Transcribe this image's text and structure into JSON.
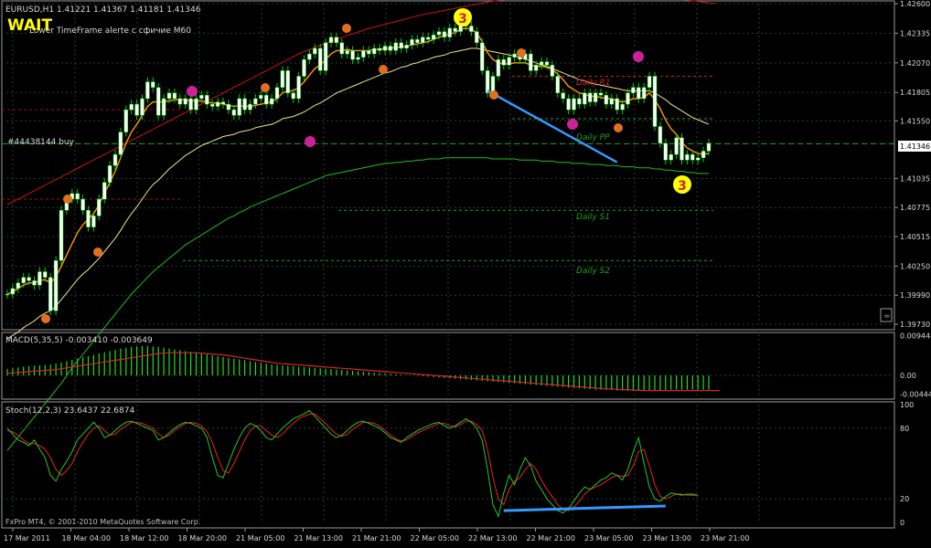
{
  "colors": {
    "bg": "#000000",
    "frame": "#9a9a9a",
    "grid": "#2a3a3a",
    "axis_text": "#d8d8d8",
    "bull": "#00d000",
    "bear": "#ffffff",
    "ma_fast": "#ff9900",
    "ma_mid": "#f0e68c",
    "ma_slow": "#22bb22",
    "envelope": "#cc1111",
    "price_line": "#20a020",
    "trend": "#3399ff",
    "marker": "#ffff00",
    "macd_hist": "#22dd22",
    "macd_signal": "#dd2222",
    "stoch_main": "#22cc22",
    "stoch_signal": "#ee2222"
  },
  "header": {
    "symbol_info": "EURUSD,H1  1.41221 1.41367 1.41181 1.41346",
    "wait_badge": "WAIT",
    "timeframe_note": "Lower TimeFrame alerte c сфичие M60",
    "order_label": "#44438144 buy",
    "watermark": "FxPro MT4, © 2001-2010 MetaQuotes Software Corp."
  },
  "pivot_labels": {
    "r1": "Daily R1",
    "pp": "Daily PP",
    "s1": "Daily S1",
    "s2": "Daily S2"
  },
  "wave_labels": {
    "top": "3",
    "bottom": "3"
  },
  "chart_data": [
    {
      "type": "line",
      "title": "EURUSD,H1",
      "ylim": [
        1.3973,
        1.426
      ],
      "y_ticks": [
        "1.42600",
        "1.42335",
        "1.42070",
        "1.41805",
        "1.41550",
        "1.41346",
        "1.41035",
        "1.40775",
        "1.40515",
        "1.40250",
        "1.39990",
        "1.39730"
      ],
      "current_price_label": "1.41346",
      "x_ticks": [
        "17 Mar 2011",
        "18 Mar 04:00",
        "18 Mar 12:00",
        "18 Mar 20:00",
        "21 Mar 05:00",
        "21 Mar 13:00",
        "21 Mar 21:00",
        "22 Mar 05:00",
        "22 Mar 13:00",
        "22 Mar 21:00",
        "23 Mar 05:00",
        "23 Mar 13:00",
        "23 Mar 21:00"
      ],
      "close": [
        1.4,
        1.4005,
        1.401,
        1.4015,
        1.4012,
        1.4008,
        1.402,
        1.4015,
        1.3985,
        1.403,
        1.4075,
        1.4085,
        1.409,
        1.4085,
        1.4075,
        1.406,
        1.407,
        1.4085,
        1.41,
        1.4115,
        1.4125,
        1.4145,
        1.4165,
        1.417,
        1.416,
        1.4175,
        1.419,
        1.4185,
        1.416,
        1.4175,
        1.418,
        1.4175,
        1.417,
        1.4175,
        1.4165,
        1.4175,
        1.4178,
        1.417,
        1.4168,
        1.4172,
        1.417,
        1.4165,
        1.416,
        1.4175,
        1.4165,
        1.417,
        1.4175,
        1.4178,
        1.417,
        1.4175,
        1.4185,
        1.42,
        1.418,
        1.4175,
        1.4195,
        1.421,
        1.4215,
        1.422,
        1.42,
        1.4225,
        1.423,
        1.4225,
        1.4215,
        1.4218,
        1.421,
        1.4212,
        1.4218,
        1.4215,
        1.422,
        1.4218,
        1.4222,
        1.4218,
        1.4225,
        1.422,
        1.4223,
        1.4228,
        1.4225,
        1.423,
        1.4228,
        1.4232,
        1.4235,
        1.423,
        1.4238,
        1.4235,
        1.4245,
        1.424,
        1.4235,
        1.4225,
        1.42,
        1.418,
        1.4195,
        1.421,
        1.4205,
        1.4212,
        1.4215,
        1.421,
        1.4215,
        1.42,
        1.4205,
        1.4208,
        1.4205,
        1.4195,
        1.418,
        1.4175,
        1.4165,
        1.4175,
        1.417,
        1.418,
        1.4172,
        1.418,
        1.4178,
        1.417,
        1.4175,
        1.4165,
        1.417,
        1.418,
        1.4185,
        1.4175,
        1.4185,
        1.4195,
        1.415,
        1.4135,
        1.412,
        1.4125,
        1.414,
        1.412,
        1.4125,
        1.412,
        1.4122,
        1.4128,
        1.4135
      ],
      "sma_fast": [
        1.4,
        1.4002,
        1.4005,
        1.4008,
        1.401,
        1.401,
        1.4012,
        1.4013,
        1.401,
        1.4015,
        1.4025,
        1.4035,
        1.4045,
        1.4055,
        1.4062,
        1.4067,
        1.4072,
        1.408,
        1.409,
        1.41,
        1.411,
        1.4122,
        1.4135,
        1.4145,
        1.4152,
        1.416,
        1.4168,
        1.4172,
        1.4172,
        1.4172,
        1.4173,
        1.4174,
        1.4174,
        1.4174,
        1.4173,
        1.4173,
        1.4173,
        1.4172,
        1.4171,
        1.4171,
        1.417,
        1.4169,
        1.4168,
        1.4169,
        1.4168,
        1.4168,
        1.4169,
        1.417,
        1.4171,
        1.4172,
        1.4175,
        1.418,
        1.4182,
        1.4182,
        1.4185,
        1.419,
        1.4196,
        1.4202,
        1.4205,
        1.421,
        1.4215,
        1.4218,
        1.4218,
        1.4219,
        1.4218,
        1.4218,
        1.4218,
        1.4218,
        1.4219,
        1.4219,
        1.422,
        1.422,
        1.4221,
        1.4221,
        1.4222,
        1.4223,
        1.4224,
        1.4225,
        1.4226,
        1.4228,
        1.423,
        1.4231,
        1.4233,
        1.4234,
        1.4237,
        1.4238,
        1.4237,
        1.4234,
        1.4226,
        1.4216,
        1.421,
        1.4207,
        1.4206,
        1.4206,
        1.4207,
        1.4207,
        1.4207,
        1.4205,
        1.4204,
        1.4204,
        1.4203,
        1.4201,
        1.4197,
        1.4192,
        1.4186,
        1.4183,
        1.418,
        1.4179,
        1.4177,
        1.4177,
        1.4176,
        1.4175,
        1.4175,
        1.4173,
        1.4172,
        1.4173,
        1.4175,
        1.4175,
        1.4176,
        1.418,
        1.4174,
        1.4166,
        1.4156,
        1.4148,
        1.4143,
        1.4136,
        1.4131,
        1.4128,
        1.4126,
        1.4125,
        1.4126
      ],
      "sma_mid": [
        1.396,
        1.3963,
        1.3966,
        1.397,
        1.3973,
        1.3976,
        1.398,
        1.3983,
        1.3985,
        1.3989,
        1.3995,
        1.4001,
        1.4007,
        1.4013,
        1.4018,
        1.4022,
        1.4027,
        1.4032,
        1.4038,
        1.4044,
        1.405,
        1.4057,
        1.4065,
        1.4072,
        1.4078,
        1.4085,
        1.4092,
        1.4098,
        1.4102,
        1.4107,
        1.4112,
        1.4116,
        1.412,
        1.4124,
        1.4127,
        1.413,
        1.4133,
        1.4135,
        1.4137,
        1.4139,
        1.4141,
        1.4142,
        1.4143,
        1.4145,
        1.4146,
        1.4147,
        1.4149,
        1.415,
        1.4151,
        1.4152,
        1.4154,
        1.4157,
        1.4158,
        1.4159,
        1.4161,
        1.4163,
        1.4166,
        1.4169,
        1.4171,
        1.4174,
        1.4177,
        1.418,
        1.4182,
        1.4184,
        1.4186,
        1.4188,
        1.419,
        1.4192,
        1.4194,
        1.4196,
        1.4198,
        1.4199,
        1.4201,
        1.4203,
        1.4204,
        1.4206,
        1.4207,
        1.4209,
        1.421,
        1.4212,
        1.4213,
        1.4214,
        1.4216,
        1.4217,
        1.4218,
        1.4219,
        1.422,
        1.422,
        1.4219,
        1.4218,
        1.4217,
        1.4216,
        1.4215,
        1.4214,
        1.4213,
        1.4212,
        1.421,
        1.4209,
        1.4207,
        1.4205,
        1.4204,
        1.4202,
        1.42,
        1.4198,
        1.4196,
        1.4194,
        1.4192,
        1.4191,
        1.4189,
        1.4188,
        1.4187,
        1.4186,
        1.4185,
        1.4184,
        1.4183,
        1.4182,
        1.4182,
        1.4182,
        1.4182,
        1.4182,
        1.418,
        1.4177,
        1.4174,
        1.417,
        1.4167,
        1.4164,
        1.4161,
        1.4158,
        1.4156,
        1.4154,
        1.4152
      ],
      "sma_slow": [
        1.386,
        1.3866,
        1.3872,
        1.3878,
        1.3884,
        1.389,
        1.3896,
        1.3902,
        1.3908,
        1.3914,
        1.392,
        1.3927,
        1.3934,
        1.394,
        1.3946,
        1.3952,
        1.3958,
        1.3964,
        1.397,
        1.3976,
        1.3982,
        1.3988,
        1.3994,
        1.4,
        1.4005,
        1.401,
        1.4015,
        1.402,
        1.4024,
        1.4028,
        1.4032,
        1.4036,
        1.404,
        1.4044,
        1.4047,
        1.405,
        1.4053,
        1.4056,
        1.4059,
        1.4062,
        1.4065,
        1.4068,
        1.407,
        1.4073,
        1.4075,
        1.4078,
        1.408,
        1.4082,
        1.4084,
        1.4086,
        1.4088,
        1.409,
        1.4092,
        1.4094,
        1.4096,
        1.4098,
        1.41,
        1.4102,
        1.4104,
        1.4106,
        1.4107,
        1.4108,
        1.4109,
        1.411,
        1.4111,
        1.4112,
        1.4113,
        1.4114,
        1.4115,
        1.4116,
        1.4117,
        1.4117,
        1.4118,
        1.4118,
        1.4119,
        1.4119,
        1.412,
        1.412,
        1.4121,
        1.4121,
        1.4121,
        1.4122,
        1.4122,
        1.4122,
        1.4122,
        1.4122,
        1.4122,
        1.4122,
        1.4122,
        1.4122,
        1.4121,
        1.4121,
        1.4121,
        1.4121,
        1.4121,
        1.412,
        1.412,
        1.412,
        1.412,
        1.4119,
        1.4119,
        1.4119,
        1.4118,
        1.4118,
        1.4118,
        1.4117,
        1.4117,
        1.4117,
        1.4116,
        1.4116,
        1.4116,
        1.4115,
        1.4115,
        1.4115,
        1.4114,
        1.4114,
        1.4114,
        1.4113,
        1.4113,
        1.4113,
        1.4112,
        1.4112,
        1.4111,
        1.4111,
        1.411,
        1.411,
        1.4109,
        1.4109,
        1.4108,
        1.4108,
        1.4108
      ],
      "envelope": [
        1.408,
        1.4088,
        1.4096,
        1.4104,
        1.4112,
        1.412,
        1.4128,
        1.4136,
        1.4144,
        1.4152,
        1.416,
        1.4168,
        1.4176,
        1.4184,
        1.4192,
        1.42,
        1.4208,
        1.4216,
        1.4222,
        1.4228,
        1.4233,
        1.4238,
        1.4242,
        1.4246,
        1.425,
        1.4253,
        1.4256,
        1.4259,
        1.4262,
        1.4264,
        1.4266,
        1.4268,
        1.4269,
        1.427,
        1.4269,
        1.4268,
        1.4267,
        1.4266,
        1.4265,
        1.4264,
        1.4262,
        1.426
      ],
      "pivots": {
        "r1": 1.4195,
        "pp": 1.4157,
        "s1": 1.4075,
        "s2": 1.403
      },
      "trend_line": [
        [
          89,
          1.4182
        ],
        [
          113,
          1.4118
        ]
      ]
    },
    {
      "type": "bar",
      "title": "MACD(5,35,5) -0.003410 -0.003649",
      "y_ticks": [
        "0.009448",
        "0.00",
        "-0.00444"
      ],
      "ylim": [
        -0.005,
        0.0098
      ],
      "histogram": [
        0.0015,
        0.0017,
        0.0019,
        0.0021,
        0.0022,
        0.0023,
        0.0024,
        0.0025,
        0.0026,
        0.0028,
        0.0031,
        0.0034,
        0.0037,
        0.004,
        0.0043,
        0.0046,
        0.0049,
        0.0052,
        0.0055,
        0.0058,
        0.0061,
        0.0064,
        0.0066,
        0.0068,
        0.0069,
        0.007,
        0.007,
        0.0069,
        0.0068,
        0.0066,
        0.0064,
        0.0062,
        0.006,
        0.0058,
        0.0056,
        0.0054,
        0.0052,
        0.005,
        0.0048,
        0.0046,
        0.0044,
        0.0042,
        0.004,
        0.0038,
        0.0036,
        0.0034,
        0.0032,
        0.003,
        0.0028,
        0.0026,
        0.0025,
        0.0024,
        0.0023,
        0.0022,
        0.0021,
        0.002,
        0.0019,
        0.0018,
        0.0017,
        0.0016,
        0.0015,
        0.0014,
        0.0013,
        0.0012,
        0.0011,
        0.001,
        0.0009,
        0.0008,
        0.0007,
        0.0006,
        0.0005,
        0.0004,
        0.0003,
        0.0002,
        0.0001,
        0.0,
        -0.0001,
        -0.0002,
        -0.0003,
        -0.0004,
        -0.0005,
        -0.0006,
        -0.0007,
        -0.0008,
        -0.0009,
        -0.001,
        -0.0011,
        -0.0012,
        -0.0013,
        -0.0014,
        -0.0015,
        -0.0016,
        -0.0017,
        -0.0018,
        -0.0019,
        -0.002,
        -0.0021,
        -0.0022,
        -0.0023,
        -0.0024,
        -0.0025,
        -0.0026,
        -0.0027,
        -0.0028,
        -0.0029,
        -0.003,
        -0.0031,
        -0.0032,
        -0.0033,
        -0.0034,
        -0.0034,
        -0.0035,
        -0.0035,
        -0.0036,
        -0.0036,
        -0.0037,
        -0.0037,
        -0.0037,
        -0.0036,
        -0.0036,
        -0.0035,
        -0.0035,
        -0.0035,
        -0.0034,
        -0.0034,
        -0.0034,
        -0.0034,
        -0.0034,
        -0.0034,
        -0.0034,
        -0.0034
      ],
      "signal": [
        0.0005,
        0.0006,
        0.0007,
        0.0008,
        0.0009,
        0.001,
        0.0011,
        0.0012,
        0.0013,
        0.0014,
        0.0016,
        0.0018,
        0.002,
        0.0022,
        0.0024,
        0.0026,
        0.0028,
        0.003,
        0.0032,
        0.0034,
        0.0036,
        0.0038,
        0.004,
        0.0042,
        0.0044,
        0.0046,
        0.0048,
        0.005,
        0.0052,
        0.0053,
        0.0054,
        0.0054,
        0.0054,
        0.0054,
        0.0054,
        0.0054,
        0.0053,
        0.0052,
        0.0051,
        0.005,
        0.0049,
        0.0047,
        0.0045,
        0.0043,
        0.0041,
        0.0039,
        0.0037,
        0.0035,
        0.0033,
        0.0031,
        0.0029,
        0.0028,
        0.0027,
        0.0026,
        0.0025,
        0.0024,
        0.0023,
        0.0022,
        0.0021,
        0.002,
        0.0019,
        0.0018,
        0.0017,
        0.0016,
        0.0015,
        0.0014,
        0.0013,
        0.0012,
        0.0011,
        0.001,
        0.0009,
        0.0008,
        0.0007,
        0.0006,
        0.0005,
        0.0004,
        0.0003,
        0.0002,
        0.0001,
        0.0,
        -0.0001,
        -0.0002,
        -0.0003,
        -0.0004,
        -0.0005,
        -0.0006,
        -0.0007,
        -0.0008,
        -0.0009,
        -0.001,
        -0.0011,
        -0.0012,
        -0.0013,
        -0.0014,
        -0.0015,
        -0.0016,
        -0.0017,
        -0.0018,
        -0.0019,
        -0.002,
        -0.0021,
        -0.0022,
        -0.0023,
        -0.0024,
        -0.0025,
        -0.0026,
        -0.0027,
        -0.0028,
        -0.0029,
        -0.003,
        -0.0031,
        -0.0032,
        -0.0032,
        -0.0033,
        -0.0034,
        -0.0034,
        -0.0035,
        -0.0035,
        -0.0036,
        -0.0036,
        -0.0036,
        -0.0036,
        -0.0036,
        -0.0036,
        -0.0036,
        -0.0036,
        -0.0036,
        -0.0036,
        -0.0036,
        -0.0036,
        -0.0036,
        -0.0036,
        -0.0036
      ]
    },
    {
      "type": "line",
      "title": "Stoch(12,2,3) 23.6437 22.6874",
      "y_ticks": [
        "100",
        "80",
        "20",
        "0"
      ],
      "ylim": [
        0,
        100
      ],
      "main": [
        80,
        75,
        70,
        68,
        65,
        70,
        62,
        55,
        40,
        35,
        45,
        52,
        60,
        70,
        75,
        80,
        85,
        80,
        72,
        74,
        78,
        82,
        85,
        86,
        84,
        82,
        80,
        78,
        70,
        72,
        76,
        80,
        83,
        85,
        84,
        82,
        80,
        72,
        55,
        40,
        38,
        50,
        62,
        72,
        80,
        84,
        82,
        78,
        72,
        70,
        75,
        80,
        84,
        88,
        90,
        92,
        95,
        90,
        85,
        80,
        75,
        72,
        74,
        78,
        82,
        85,
        86,
        84,
        82,
        80,
        76,
        72,
        70,
        68,
        72,
        75,
        78,
        80,
        82,
        84,
        85,
        82,
        80,
        82,
        85,
        88,
        85,
        80,
        70,
        45,
        15,
        5,
        25,
        40,
        32,
        45,
        55,
        48,
        35,
        28,
        20,
        15,
        10,
        8,
        12,
        18,
        25,
        30,
        28,
        32,
        36,
        38,
        42,
        40,
        36,
        45,
        60,
        72,
        50,
        30,
        20,
        18,
        22,
        25,
        24,
        23,
        24,
        24,
        23
      ],
      "signal": [
        78,
        77,
        74,
        70,
        67,
        67,
        65,
        62,
        55,
        45,
        40,
        44,
        50,
        60,
        68,
        75,
        80,
        82,
        78,
        74,
        75,
        79,
        82,
        85,
        85,
        84,
        82,
        80,
        75,
        72,
        74,
        78,
        81,
        84,
        85,
        84,
        82,
        77,
        68,
        55,
        44,
        42,
        50,
        60,
        70,
        78,
        82,
        82,
        78,
        74,
        72,
        75,
        80,
        84,
        88,
        90,
        92,
        92,
        88,
        84,
        79,
        75,
        73,
        75,
        79,
        82,
        85,
        85,
        84,
        82,
        78,
        74,
        71,
        69,
        70,
        73,
        76,
        78,
        80,
        82,
        84,
        84,
        82,
        81,
        83,
        86,
        86,
        83,
        78,
        62,
        38,
        20,
        15,
        28,
        35,
        38,
        45,
        50,
        45,
        36,
        28,
        22,
        15,
        11,
        10,
        13,
        18,
        24,
        28,
        30,
        32,
        35,
        38,
        40,
        39,
        40,
        48,
        60,
        62,
        48,
        32,
        22,
        20,
        22,
        24,
        24,
        23,
        23,
        23
      ],
      "divergence_line": [
        [
          92,
          10
        ],
        [
          122,
          14
        ]
      ]
    }
  ]
}
